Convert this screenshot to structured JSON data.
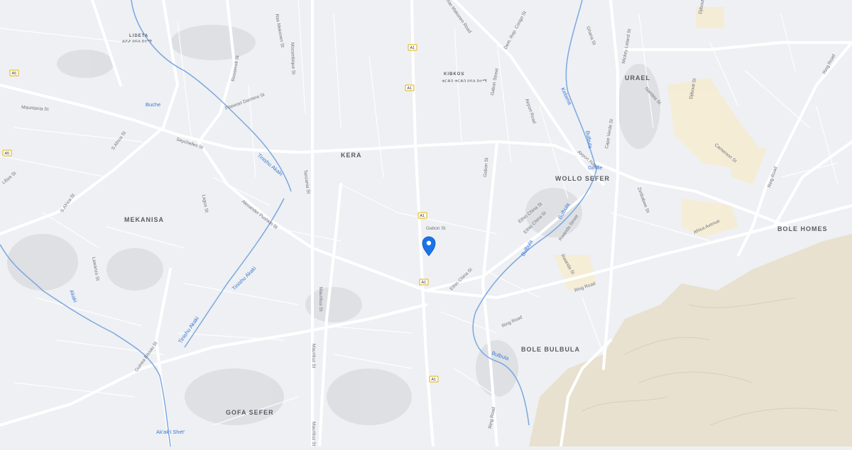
{
  "map": {
    "areas": [
      "LIDETA",
      "KIBKOS",
      "KERA",
      "URAEL",
      "MEKANISA",
      "WOLLO SEFER",
      "BOLE HOMES",
      "BOLE BULBULA",
      "GOFA SEFER"
    ],
    "area_scripts": [
      "ልደታ ክፍለ ከተማ",
      "ቂርቆስ ቀርቆስ ክፍለ ከተማ"
    ],
    "roads": [
      "Ras Makonen Road",
      "Roosevelt St",
      "Ras Mekonen St",
      "Mozambique St",
      "Dem. Rep. Congo St",
      "Gabon Street",
      "Airport Road",
      "Ghana St",
      "Mickey Leland St",
      "Djibouti St",
      "Ring Road",
      "Mauritania St",
      "Fitawrari Damtew St",
      "S Africa St",
      "Seychelles St",
      "Gabon St",
      "Cape Verde St",
      "Nambia St",
      "Djibouti St",
      "Cameroon St",
      "Airport Road",
      "Ring Road",
      "Libya St",
      "S Africa St",
      "Alexander Pushkin St",
      "Tanzania St",
      "Lagos St",
      "Gabon St",
      "Ethio China St",
      "Rwanda Street",
      "Zimbabwe St",
      "Africa Avenue",
      "Lawanzo St",
      "Mauritius St",
      "Ethio China St",
      "Rwanda St",
      "Ring Road",
      "Ring Road",
      "Guinea Bissau St",
      "Mauritius St",
      "Mauritius St",
      "Ring Road",
      "Ethio China St"
    ],
    "rivers": [
      "Buche",
      "Tinishu Akaki",
      "Tinishu Akaki",
      "Tinishu Akaki",
      "Akaki",
      "Kebena",
      "Bulbula",
      "Bulbula",
      "Bulbula",
      "Bulbula",
      "Ak'ak'i Shet'",
      "Gir'iile"
    ],
    "route_shields": [
      "A1",
      "A1",
      "A1",
      "A1",
      "A1",
      "A5",
      "A5"
    ],
    "marker": {
      "name": "location-pin",
      "color": "#1a73e8"
    }
  }
}
